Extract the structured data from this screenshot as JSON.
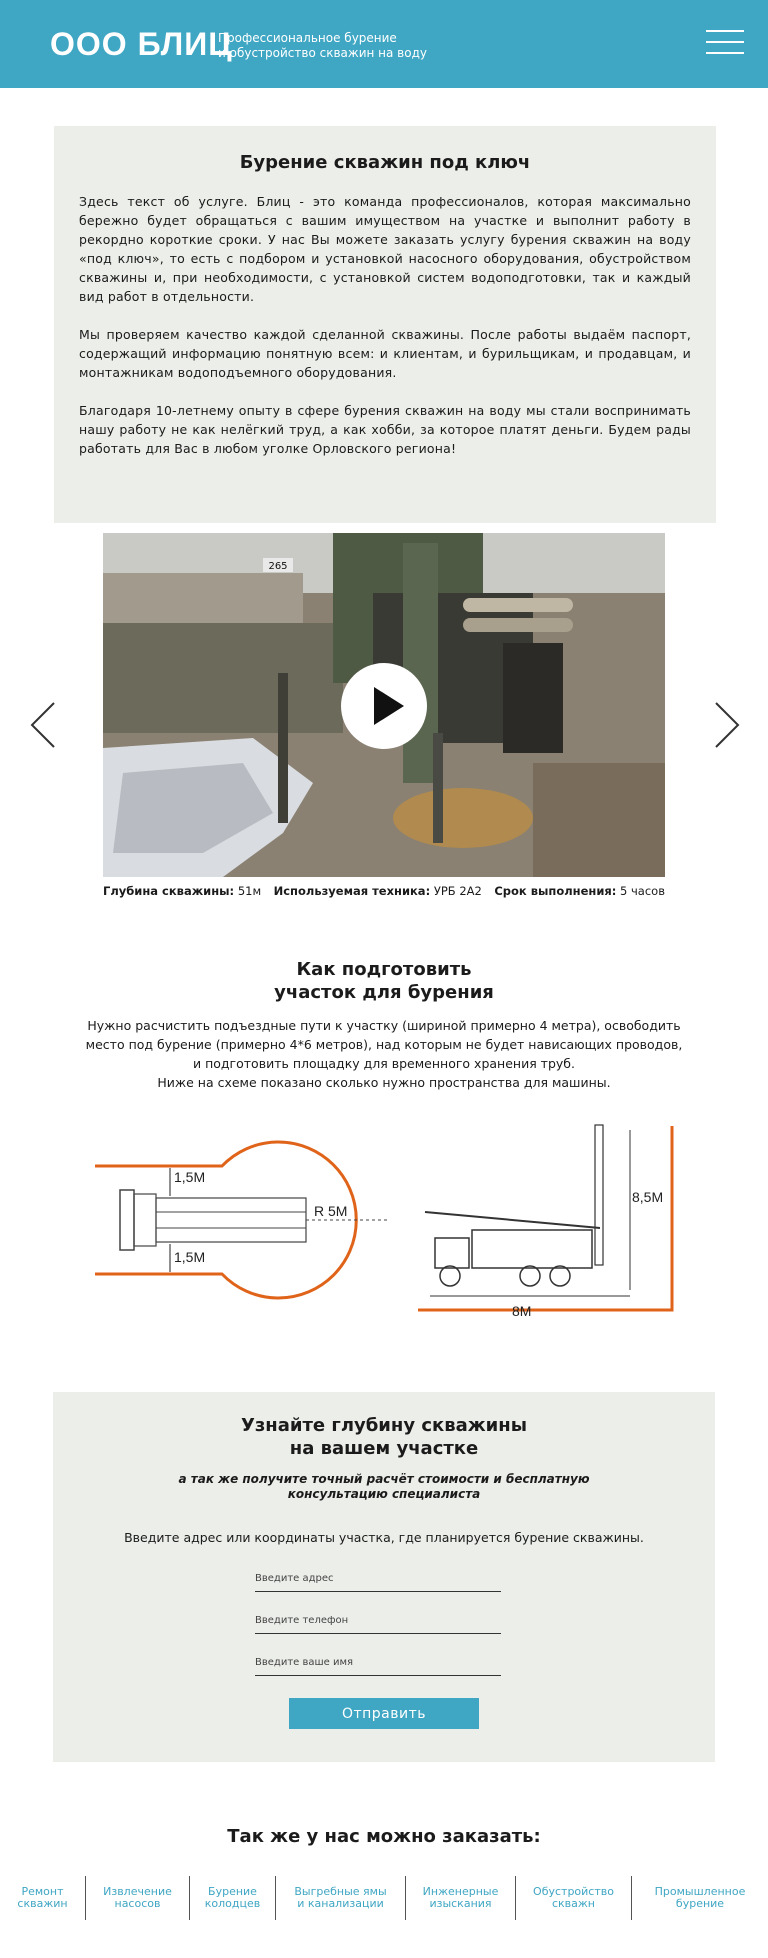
{
  "header": {
    "logo": "ООО БЛИЦ",
    "tagline_line1": "Профессиональное бурение",
    "tagline_line2": "и обустройство скважин на воду"
  },
  "service": {
    "title": "Бурение скважин под ключ",
    "paragraphs": [
      "Здесь текст об услуге. Блиц - это команда профессионалов, которая максимально бережно будет обращаться с вашим имуществом на участке и выполнит работу в рекордно короткие сроки. У нас Вы можете заказать услугу бурения скважин на воду «под ключ», то есть с подбором и установкой насосного оборудования, обустройством скважины и, при необходимости, с установкой систем водоподготовки, так и каждый вид работ в отдельности.",
      "Мы проверяем качество каждой сделанной скважины. После работы  выдаём паспорт, содержащий информацию понятную всем: и клиентам, и бурильщикам, и продавцам, и монтажникам водоподъемного оборудования.",
      "Благодаря 10-летнему опыту в сфере бурения скважин на воду мы стали воспринимать нашу работу не как нелёгкий труд, а как хобби, за которое платят деньги. Будем рады работать для Вас в любом уголке Орловского региона!"
    ]
  },
  "gallery": {
    "plate_text": "265",
    "depth_label": "Глубина скважины:",
    "depth_value": "51м",
    "equipment_label": "Используемая техника:",
    "equipment_value": "УРБ 2А2",
    "term_label": "Срок выполнения:",
    "term_value": "5 часов"
  },
  "prep": {
    "title_line1": "Как подготовить",
    "title_line2": "участок для бурения",
    "text_line1": "Нужно расчистить подъездные пути к участку (шириной примерно 4 метра), освободить",
    "text_line2": "место под бурение (примерно 4*6 метров), над которым не будет нависающих проводов,",
    "text_line3": "и подготовить площадку для временного хранения труб.",
    "text_line4": "Ниже на схеме показано сколько нужно пространства для машины.",
    "scheme": {
      "top_gap": "1,5М",
      "bottom_gap": "1,5М",
      "radius": "R 5М",
      "height": "8,5М",
      "length": "8М"
    }
  },
  "form": {
    "title_line1": "Узнайте глубину скважины",
    "title_line2": "на вашем участке",
    "subtitle_line1": "а так же получите точный расчёт стоимости и бесплатную",
    "subtitle_line2": "консультацию специалиста",
    "description": "Введите адрес или координаты участка, где планируется бурение скважины.",
    "address_placeholder": "Введите адрес",
    "phone_placeholder": "Введите телефон",
    "name_placeholder": "Введите ваше имя",
    "submit_label": "Отправить"
  },
  "also": {
    "title": "Так же у нас можно заказать:",
    "items": [
      {
        "line1": "Ремонт",
        "line2": "скважин"
      },
      {
        "line1": "Извлечение",
        "line2": "насосов"
      },
      {
        "line1": "Бурение",
        "line2": "колодцев"
      },
      {
        "line1": "Выгребные ямы",
        "line2": "и канализации"
      },
      {
        "line1": "Инженерные",
        "line2": "изыскания"
      },
      {
        "line1": "Обустройство",
        "line2": "скважн"
      },
      {
        "line1": "Промышленное",
        "line2": "бурение"
      }
    ]
  },
  "colors": {
    "accent": "#3fa6c3",
    "panel": "#eceee9",
    "scheme_outline": "#e0631a"
  }
}
